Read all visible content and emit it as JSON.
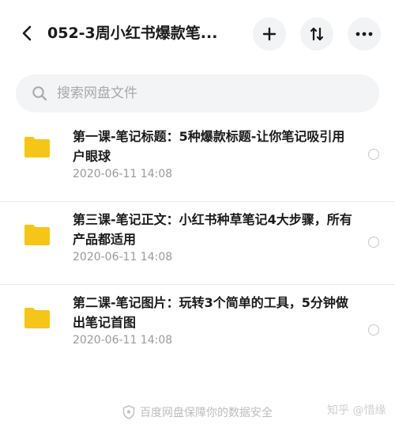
{
  "header": {
    "title": "052-3周小红书爆款笔...",
    "back_icon": "chevron-left-icon",
    "add_icon": "plus-icon",
    "sort_icon": "sort-icon",
    "more_icon": "more-dots-icon"
  },
  "search": {
    "placeholder": "搜索网盘文件"
  },
  "files": [
    {
      "name": "第一课-笔记标题：5种爆款标题-让你笔记吸引用户眼球",
      "date": "2020-06-11  14:08",
      "icon": "folder-icon"
    },
    {
      "name": "第三课-笔记正文：小红书种草笔记4大步骤，所有产品都适用",
      "date": "2020-06-11  14:08",
      "icon": "folder-icon"
    },
    {
      "name": "第二课-笔记图片：玩转3个简单的工具，5分钟做出笔记首图",
      "date": "2020-06-11  14:08",
      "icon": "folder-icon"
    }
  ],
  "footer": {
    "text": "百度网盘保障你的数据安全",
    "icon": "shield-icon"
  },
  "watermark": {
    "text": "知乎 @惜缘"
  },
  "colors": {
    "folder": "#f5c518",
    "button_bg": "#f2f3f5",
    "search_bg": "#f3f4f6",
    "muted_text": "#9a9a9a"
  }
}
